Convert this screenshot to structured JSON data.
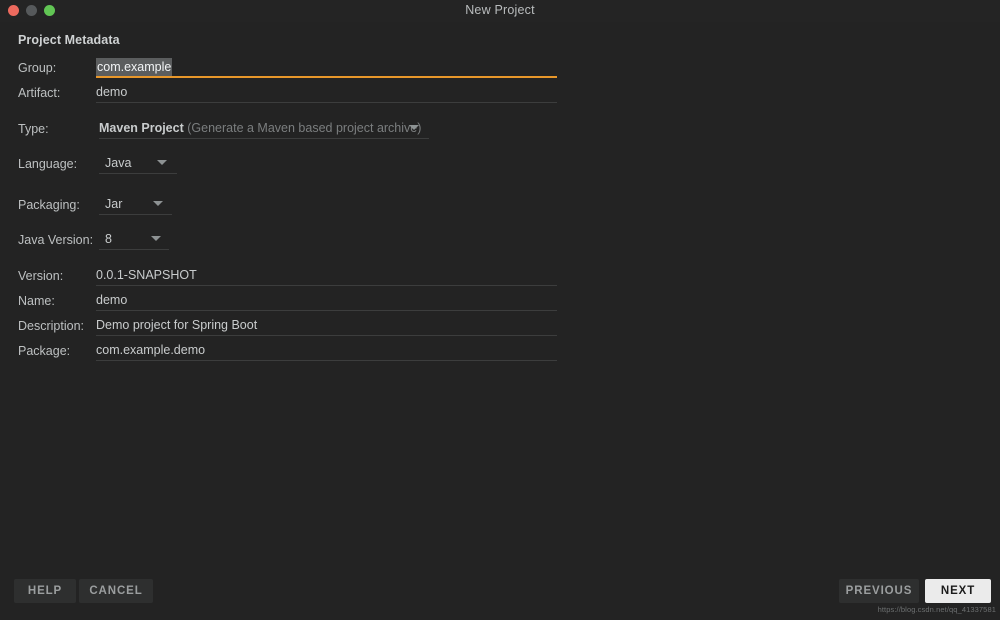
{
  "window": {
    "title": "New Project",
    "traffic_lights": [
      {
        "name": "close",
        "color": "#ed6a5e"
      },
      {
        "name": "minimize",
        "color": "#56595b"
      },
      {
        "name": "zoom",
        "color": "#61c554"
      }
    ]
  },
  "section": {
    "title": "Project Metadata"
  },
  "form": {
    "group": {
      "label": "Group:",
      "value": "com.example",
      "focused": true,
      "accent_color": "#e8972a"
    },
    "artifact": {
      "label": "Artifact:",
      "value": "demo"
    },
    "type": {
      "label": "Type:",
      "value": "Maven Project",
      "hint": "(Generate a Maven based project archive)",
      "caret_icon": "chevron-down-icon"
    },
    "language": {
      "label": "Language:",
      "value": "Java",
      "caret_icon": "chevron-down-icon"
    },
    "packaging": {
      "label": "Packaging:",
      "value": "Jar",
      "caret_icon": "chevron-down-icon"
    },
    "java_version": {
      "label": "Java Version:",
      "value": "8",
      "caret_icon": "chevron-down-icon"
    },
    "version": {
      "label": "Version:",
      "value": "0.0.1-SNAPSHOT"
    },
    "name": {
      "label": "Name:",
      "value": "demo"
    },
    "description": {
      "label": "Description:",
      "value": "Demo project for Spring Boot"
    },
    "package": {
      "label": "Package:",
      "value": "com.example.demo"
    }
  },
  "footer": {
    "help_label": "HELP",
    "cancel_label": "CANCEL",
    "previous_label": "PREVIOUS",
    "next_label": "NEXT",
    "watermark": "https://blog.csdn.net/qq_41337581"
  }
}
